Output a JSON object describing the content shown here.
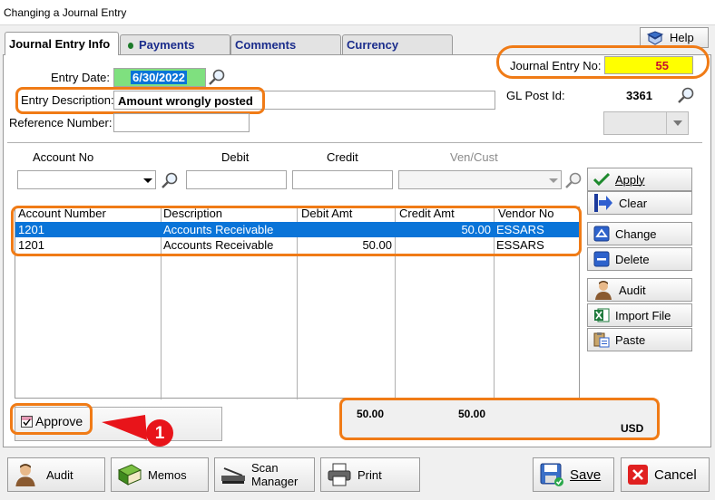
{
  "window": {
    "title": "Changing a Journal Entry"
  },
  "tabs": [
    {
      "label": "Journal Entry Info",
      "active": true
    },
    {
      "label": "Payments",
      "active": false
    },
    {
      "label": "Comments",
      "active": false
    },
    {
      "label": "Currency",
      "active": false
    }
  ],
  "help": {
    "label": "Help"
  },
  "form": {
    "entry_date_label": "Entry Date:",
    "entry_date_value": "6/30/2022",
    "entry_desc_label": "Entry Description:",
    "entry_desc_value": "Amount wrongly posted",
    "ref_label": "Reference Number:",
    "ref_value": "",
    "je_no_label": "Journal Entry No:",
    "je_no_value": "55",
    "gl_post_label": "GL Post Id:",
    "gl_post_value": "3361"
  },
  "entry_inputs": {
    "account_no_label": "Account No",
    "debit_label": "Debit",
    "credit_label": "Credit",
    "vencust_label": "Ven/Cust"
  },
  "grid": {
    "columns": [
      "Account Number",
      "Description",
      "Debit Amt",
      "Credit Amt",
      "Vendor No"
    ],
    "rows": [
      {
        "account": "1201",
        "description": "Accounts Receivable",
        "debit": "",
        "credit": "50.00",
        "vendor": "ESSARS",
        "selected": true
      },
      {
        "account": "1201",
        "description": "Accounts Receivable",
        "debit": "50.00",
        "credit": "",
        "vendor": "ESSARS",
        "selected": false
      }
    ]
  },
  "side_buttons": {
    "apply": "Apply",
    "clear": "Clear",
    "change": "Change",
    "delete": "Delete",
    "audit": "Audit",
    "import": "Import File",
    "paste": "Paste"
  },
  "approve": {
    "label": "Approve",
    "checked": true
  },
  "totals": {
    "debit": "50.00",
    "credit": "50.00",
    "currency": "USD"
  },
  "callout": {
    "number": "1"
  },
  "bottom_buttons": {
    "audit": "Audit",
    "memos": "Memos",
    "scan_line1": "Scan",
    "scan_line2": "Manager",
    "print": "Print",
    "save": "Save",
    "cancel": "Cancel"
  },
  "colors": {
    "accent_orange": "#f07b16",
    "selection_blue": "#0a74d8",
    "je_no_bg": "#ffff00",
    "date_bg": "#7fe07f",
    "callout_red": "#e8141a"
  }
}
